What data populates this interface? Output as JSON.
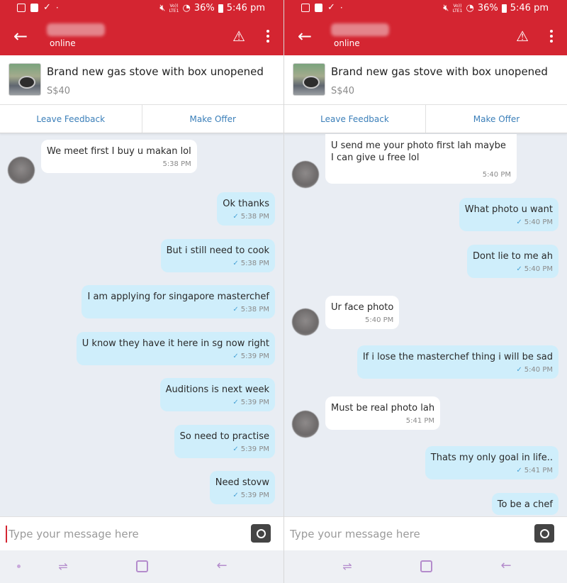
{
  "status_bar": {
    "battery": "36%",
    "time": "5:46 pm",
    "network": "Vo)) LTE1"
  },
  "chat_header": {
    "status": "online"
  },
  "listing": {
    "title": "Brand new gas stove with box unopened",
    "price": "S$40"
  },
  "actions": {
    "feedback": "Leave Feedback",
    "offer": "Make Offer"
  },
  "composer": {
    "placeholder": "Type your message here"
  },
  "left_messages": [
    {
      "text": "We meet first I buy u makan lol",
      "time": "5:38 PM"
    },
    {
      "text": "Ok thanks",
      "time": "5:38 PM"
    },
    {
      "text": "But i still need to cook",
      "time": "5:38 PM"
    },
    {
      "text": "I am applying for singapore masterchef",
      "time": "5:38 PM"
    },
    {
      "text": "U know they have it here in sg now right",
      "time": "5:39 PM"
    },
    {
      "text": "Auditions is next week",
      "time": "5:39 PM"
    },
    {
      "text": "So need to practise",
      "time": "5:39 PM"
    },
    {
      "text": "Need stovw",
      "time": "5:39 PM"
    }
  ],
  "right_messages": [
    {
      "text": "U send me your photo first lah maybe I can give u free lol",
      "time": "5:40 PM"
    },
    {
      "text": "What photo u want",
      "time": "5:40 PM"
    },
    {
      "text": "Dont lie to me ah",
      "time": "5:40 PM"
    },
    {
      "text": "Ur face photo",
      "time": "5:40 PM"
    },
    {
      "text": "If i lose the masterchef thing i will be sad",
      "time": "5:40 PM"
    },
    {
      "text": "Must be real photo lah",
      "time": "5:41 PM"
    },
    {
      "text": "Thats my only goal in life..",
      "time": "5:41 PM"
    },
    {
      "text": "To be a chef",
      "time": ""
    }
  ],
  "icons": {
    "back": "arrow-left-icon",
    "warning": "warning-icon",
    "more": "more-vertical-icon",
    "camera": "camera-icon",
    "read_receipt": "check-icon"
  },
  "colors": {
    "brand": "#d42531",
    "outgoing_bubble": "#cfeefb",
    "incoming_bubble": "#ffffff",
    "link": "#3b7fb9"
  }
}
